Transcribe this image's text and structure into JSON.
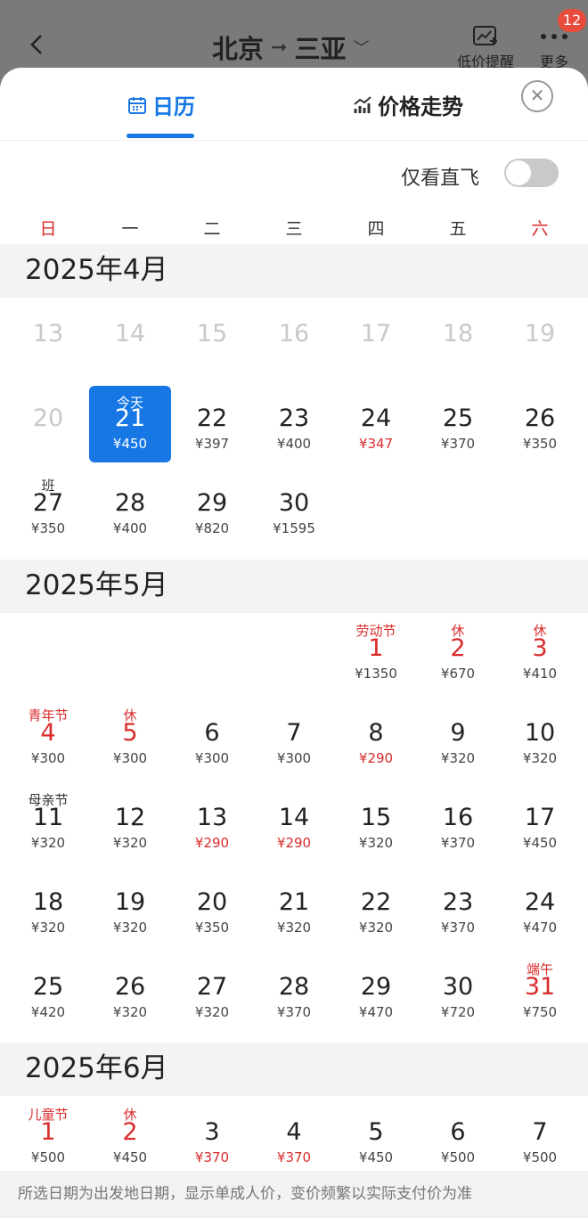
{
  "header": {
    "title_from": "北京",
    "title_to": "三亚",
    "price_alert_label": "低价提醒",
    "more_label": "更多",
    "badge_count": "12"
  },
  "tabs": [
    {
      "label": "日历"
    },
    {
      "label": "价格走势"
    }
  ],
  "filter": {
    "label": "仅看直飞",
    "enabled": false
  },
  "weekdays": [
    "日",
    "一",
    "二",
    "三",
    "四",
    "五",
    "六"
  ],
  "months": [
    {
      "title": "2025年4月",
      "cells": [
        {
          "day": "13",
          "muted": true
        },
        {
          "day": "14",
          "muted": true
        },
        {
          "day": "15",
          "muted": true
        },
        {
          "day": "16",
          "muted": true
        },
        {
          "day": "17",
          "muted": true
        },
        {
          "day": "18",
          "muted": true
        },
        {
          "day": "19",
          "muted": true
        },
        {
          "day": "20",
          "muted": true
        },
        {
          "day": "21",
          "price": "¥450",
          "label": "今天",
          "selected": true
        },
        {
          "day": "22",
          "price": "¥397"
        },
        {
          "day": "23",
          "price": "¥400"
        },
        {
          "day": "24",
          "price": "¥347",
          "price_red": true
        },
        {
          "day": "25",
          "price": "¥370"
        },
        {
          "day": "26",
          "price": "¥350"
        },
        {
          "day": "27",
          "price": "¥350",
          "label": "班"
        },
        {
          "day": "28",
          "price": "¥400"
        },
        {
          "day": "29",
          "price": "¥820"
        },
        {
          "day": "30",
          "price": "¥1595"
        }
      ]
    },
    {
      "title": "2025年5月",
      "cells": [
        {
          "day": "1",
          "price": "¥1350",
          "label": "劳动节",
          "holiday": true
        },
        {
          "day": "2",
          "price": "¥670",
          "label": "休",
          "holiday": true
        },
        {
          "day": "3",
          "price": "¥410",
          "label": "休",
          "holiday": true
        },
        {
          "day": "4",
          "price": "¥300",
          "label": "青年节",
          "holiday": true
        },
        {
          "day": "5",
          "price": "¥300",
          "label": "休",
          "holiday": true
        },
        {
          "day": "6",
          "price": "¥300"
        },
        {
          "day": "7",
          "price": "¥300"
        },
        {
          "day": "8",
          "price": "¥290",
          "price_red": true
        },
        {
          "day": "9",
          "price": "¥320"
        },
        {
          "day": "10",
          "price": "¥320"
        },
        {
          "day": "11",
          "price": "¥320",
          "label": "母亲节"
        },
        {
          "day": "12",
          "price": "¥320"
        },
        {
          "day": "13",
          "price": "¥290",
          "price_red": true
        },
        {
          "day": "14",
          "price": "¥290",
          "price_red": true
        },
        {
          "day": "15",
          "price": "¥320"
        },
        {
          "day": "16",
          "price": "¥370"
        },
        {
          "day": "17",
          "price": "¥450"
        },
        {
          "day": "18",
          "price": "¥320"
        },
        {
          "day": "19",
          "price": "¥320"
        },
        {
          "day": "20",
          "price": "¥350"
        },
        {
          "day": "21",
          "price": "¥320"
        },
        {
          "day": "22",
          "price": "¥320"
        },
        {
          "day": "23",
          "price": "¥370"
        },
        {
          "day": "24",
          "price": "¥470"
        },
        {
          "day": "25",
          "price": "¥420"
        },
        {
          "day": "26",
          "price": "¥320"
        },
        {
          "day": "27",
          "price": "¥320"
        },
        {
          "day": "28",
          "price": "¥370"
        },
        {
          "day": "29",
          "price": "¥470"
        },
        {
          "day": "30",
          "price": "¥720"
        },
        {
          "day": "31",
          "price": "¥750",
          "label": "端午",
          "holiday": true
        }
      ]
    },
    {
      "title": "2025年6月",
      "cells": [
        {
          "day": "1",
          "price": "¥500",
          "label": "儿童节",
          "holiday": true
        },
        {
          "day": "2",
          "price": "¥450",
          "label": "休",
          "holiday": true
        },
        {
          "day": "3",
          "price": "¥370",
          "price_red": true
        },
        {
          "day": "4",
          "price": "¥370",
          "price_red": true
        },
        {
          "day": "5",
          "price": "¥450"
        },
        {
          "day": "6",
          "price": "¥500"
        },
        {
          "day": "7",
          "price": "¥500"
        }
      ]
    }
  ],
  "footer_note": "所选日期为出发地日期，显示单成人价，变价频繁以实际支付价为准",
  "colors": {
    "accent": "#1677e5",
    "holiday_red": "#d92b2b",
    "muted": "#c9c9c9"
  }
}
